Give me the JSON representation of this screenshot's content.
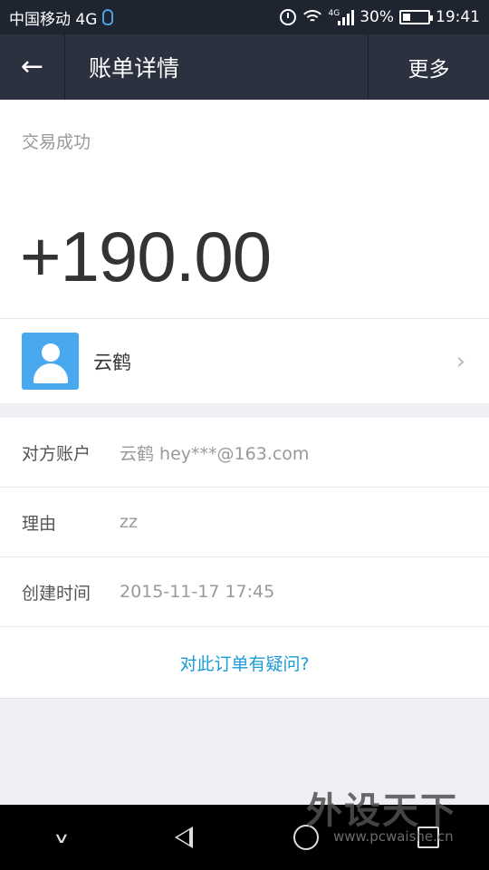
{
  "status_bar": {
    "carrier": "中国移动 4G",
    "net_small": "4G",
    "battery": "30%",
    "battery_level": 0.3,
    "time": "19:41"
  },
  "header": {
    "title": "账单详情",
    "more_label": "更多",
    "back_icon": "arrow-left-icon"
  },
  "summary": {
    "status": "交易成功",
    "amount": "+190.00",
    "payer_name": "云鹤"
  },
  "details": [
    {
      "label": "对方账户",
      "value": "云鹤 hey***@163.com"
    },
    {
      "label": "理由",
      "value": "zz"
    },
    {
      "label": "创建时间",
      "value": "2015-11-17 17:45"
    }
  ],
  "question_link": "对此订单有疑问?",
  "watermark": {
    "main": "外设天下",
    "sub": "www.pcwaishe.cn"
  },
  "colors": {
    "status_bar_bg": "#1f2431",
    "header_bg": "#2c3140",
    "accent_link": "#1a9bd7",
    "avatar_bg": "#49a9ee"
  }
}
